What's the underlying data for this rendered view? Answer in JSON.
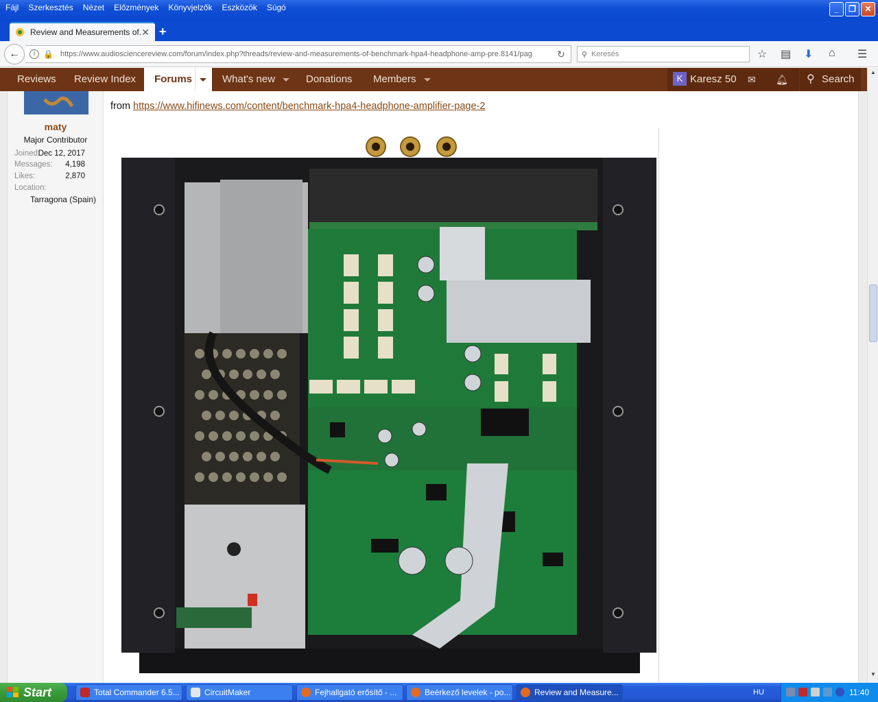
{
  "window": {
    "menu": [
      "Fájl",
      "Szerkesztés",
      "Nézet",
      "Előzmények",
      "Könyvjelzők",
      "Eszközök",
      "Súgó"
    ]
  },
  "browser": {
    "tab_title": "Review and Measurements of...",
    "url": "https://www.audiosciencereview.com/forum/index.php?threads/review-and-measurements-of-benchmark-hpa4-headphone-amp-pre.8141/pag",
    "search_placeholder": "Keresés"
  },
  "forum_nav": {
    "items": [
      "Reviews",
      "Review Index",
      "Forums",
      "What's new",
      "Donations",
      "Members"
    ],
    "active": "Forums",
    "user_initial": "K",
    "user_name": "Karesz 50",
    "search_label": "Search"
  },
  "post": {
    "author": {
      "name": "maty",
      "title": "Major Contributor",
      "joined_label": "Joined:",
      "joined": "Dec 12, 2017",
      "messages_label": "Messages:",
      "messages": "4,198",
      "likes_label": "Likes:",
      "likes": "2,870",
      "location_label": "Location:",
      "location": "Tarragona (Spain)"
    },
    "from_prefix": "from",
    "link": "https://www.hifinews.com/content/benchmark-hpa4-headphone-amplifier-page-2"
  },
  "taskbar": {
    "start": "Start",
    "items": [
      {
        "label": "Total Commander 6.5...",
        "active": false
      },
      {
        "label": "CircuitMaker",
        "active": false
      },
      {
        "label": "Fejhallgató erősítő - ...",
        "active": false
      },
      {
        "label": "Beérkező levelek - po...",
        "active": false
      },
      {
        "label": "Review and Measure...",
        "active": true
      }
    ],
    "language": "HU",
    "time": "11:40"
  },
  "colors": {
    "forum_header": "#6d3415",
    "link": "#8a4b16",
    "xp_blue": "#245edb",
    "pcb_green": "#1f7a3a"
  }
}
